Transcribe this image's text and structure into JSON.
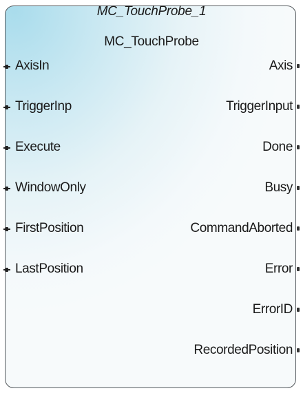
{
  "block": {
    "instance_name": "MC_TouchProbe_1",
    "type_name": "MC_TouchProbe"
  },
  "inputs": [
    "AxisIn",
    "TriggerInp",
    "Execute",
    "WindowOnly",
    "FirstPosition",
    "LastPosition"
  ],
  "outputs": [
    "Axis",
    "TriggerInput",
    "Done",
    "Busy",
    "CommandAborted",
    "Error",
    "ErrorID",
    "RecordedPosition"
  ]
}
